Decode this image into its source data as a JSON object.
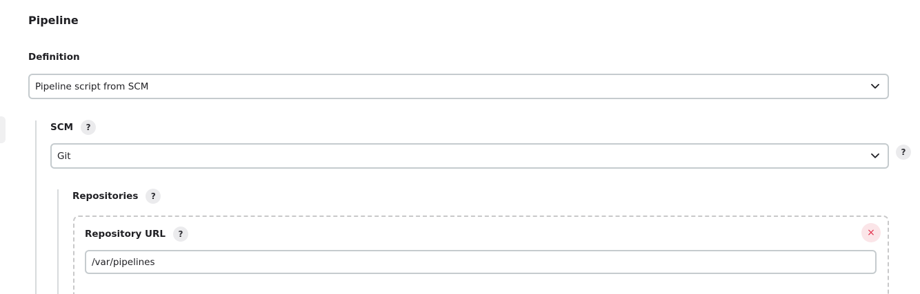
{
  "section": {
    "title": "Pipeline"
  },
  "definition": {
    "label": "Definition",
    "selected": "Pipeline script from SCM"
  },
  "scm": {
    "label": "SCM",
    "help": "?",
    "selected": "Git",
    "side_help": "?"
  },
  "repositories": {
    "label": "Repositories",
    "help": "?",
    "repository_url": {
      "label": "Repository URL",
      "help": "?",
      "value": "/var/pipelines"
    },
    "remove_icon": "×"
  },
  "icons": {
    "dropdown": "chevron-down-icon",
    "help": "question-mark-icon",
    "remove": "close-icon"
  },
  "colors": {
    "remove_accent": "#e2304b",
    "border": "#c5cbce"
  }
}
